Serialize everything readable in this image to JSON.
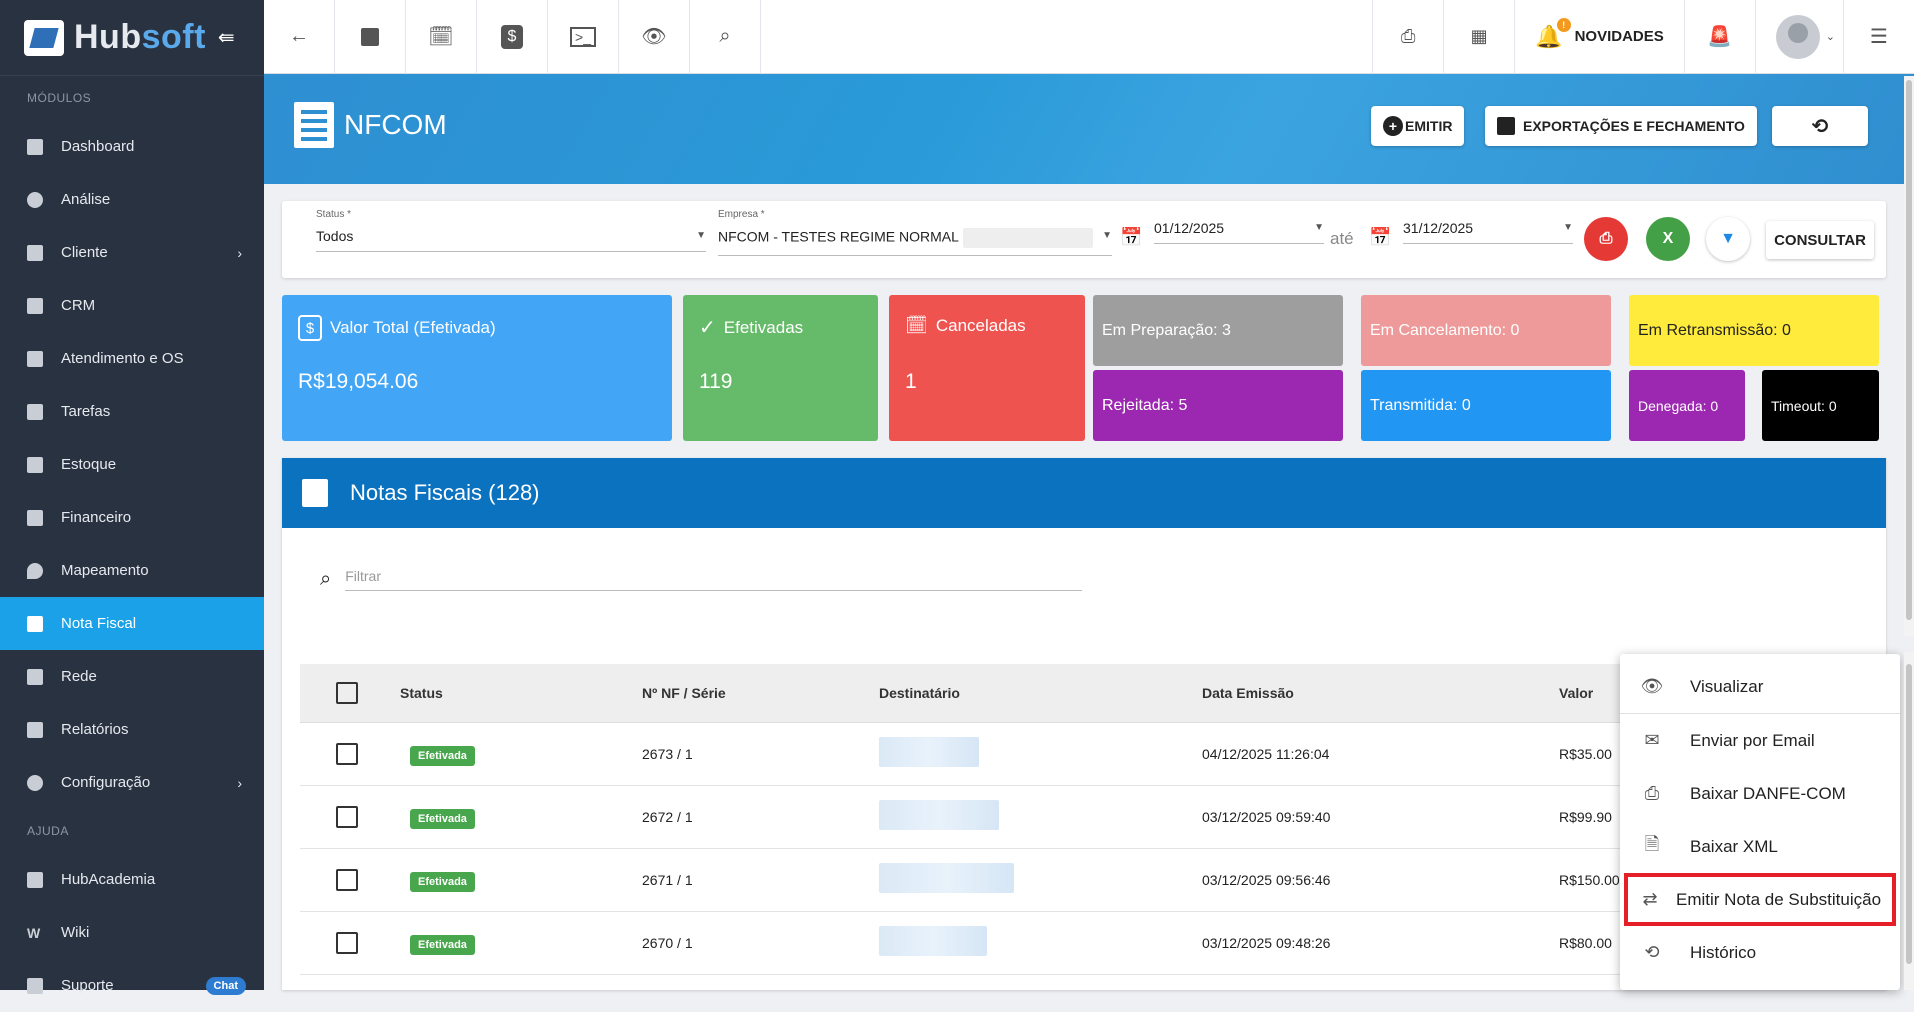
{
  "sidebar": {
    "brand_a": "Hub",
    "brand_b": "soft",
    "section_modules": "MÓDULOS",
    "items": [
      "Dashboard",
      "Análise",
      "Cliente",
      "CRM",
      "Atendimento e OS",
      "Tarefas",
      "Estoque",
      "Financeiro",
      "Mapeamento",
      "Nota Fiscal",
      "Rede",
      "Relatórios",
      "Configuração"
    ],
    "section_help": "AJUDA",
    "help_items": [
      "HubAcademia",
      "Wiki",
      "Suporte"
    ],
    "chat_badge": "Chat"
  },
  "topbar": {
    "novidades": "NOVIDADES",
    "notif_count": "!"
  },
  "page": {
    "title": "NFCOM",
    "btn_emitir": "EMITIR",
    "btn_export": "EXPORTAÇÕES E FECHAMENTO"
  },
  "filters": {
    "status_label": "Status *",
    "status_value": "Todos",
    "empresa_label": "Empresa *",
    "empresa_value": "NFCOM - TESTES REGIME NORMAL",
    "date_from": "01/12/2025",
    "ate": "até",
    "date_to": "31/12/2025",
    "consultar": "CONSULTAR"
  },
  "cards": {
    "valor_label": "Valor Total (Efetivada)",
    "valor": "R$19,054.06",
    "efetivadas_label": "Efetivadas",
    "efetivadas": "119",
    "canceladas_label": "Canceladas",
    "canceladas": "1",
    "em_preparacao": "Em Preparação: 3",
    "em_cancelamento": "Em Cancelamento: 0",
    "em_retransmissao": "Em Retransmissão: 0",
    "rejeitada": "Rejeitada: 5",
    "transmitida": "Transmitida: 0",
    "denegada": "Denegada: 0",
    "timeout": "Timeout: 0"
  },
  "panel": {
    "title": "Notas Fiscais (128)",
    "filter_placeholder": "Filtrar"
  },
  "table": {
    "headers": {
      "status": "Status",
      "nf": "Nº NF / Série",
      "dest": "Destinatário",
      "data": "Data Emissão",
      "valor": "Valor"
    },
    "rows": [
      {
        "status": "Efetivada",
        "nf": "2673 / 1",
        "data": "04/12/2025 11:26:04",
        "valor": "R$35.00"
      },
      {
        "status": "Efetivada",
        "nf": "2672 / 1",
        "data": "03/12/2025 09:59:40",
        "valor": "R$99.90"
      },
      {
        "status": "Efetivada",
        "nf": "2671 / 1",
        "data": "03/12/2025 09:56:46",
        "valor": "R$150.00"
      },
      {
        "status": "Efetivada",
        "nf": "2670 / 1",
        "data": "03/12/2025 09:48:26",
        "valor": "R$80.00"
      }
    ]
  },
  "menu": [
    "Visualizar",
    "Enviar por Email",
    "Baixar DANFE-COM",
    "Baixar XML",
    "Emitir Nota de Substituição",
    "Histórico"
  ],
  "colors": {
    "sidebar": "#293241",
    "active": "#1aa1e8",
    "header": "#0b72bf",
    "blue_card": "#42a5f5",
    "green_card": "#66bb6a",
    "red_card": "#ef5350",
    "gray_card": "#9e9e9e",
    "pink_card": "#ef9a9a",
    "purple_card": "#9c27b0",
    "yellow_card": "#ffeb3b",
    "blue2_card": "#2196f3",
    "black_card": "#000000",
    "highlight": "#e61e28"
  }
}
